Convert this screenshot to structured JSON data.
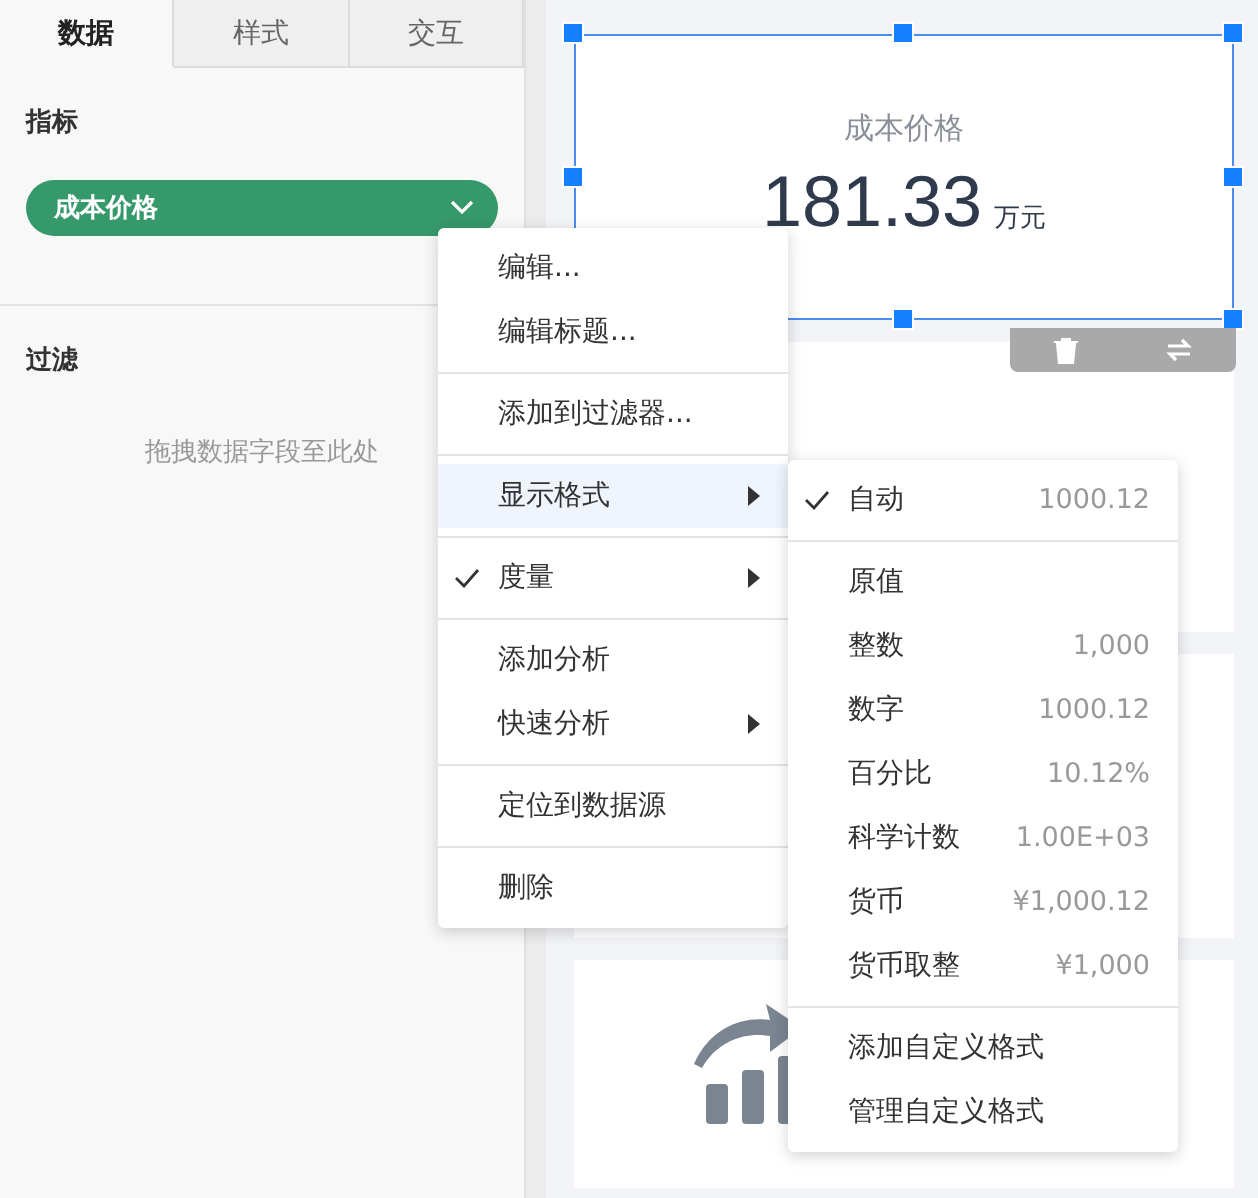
{
  "tabs": [
    {
      "label": "数据",
      "selected": true
    },
    {
      "label": "样式",
      "selected": false
    },
    {
      "label": "交互",
      "selected": false
    }
  ],
  "sidebar": {
    "measure_title": "指标",
    "measure": {
      "label": "成本价格"
    },
    "filter_title": "过滤",
    "filter_placeholder": "拖拽数据字段至此处"
  },
  "canvas": {
    "cards": [
      {
        "kind": "metric",
        "selected": true,
        "title": "成本价格",
        "value": "181.33",
        "unit": "万元"
      },
      {
        "kind": "blank",
        "selected": false
      },
      {
        "kind": "blank",
        "selected": false
      },
      {
        "kind": "icon",
        "selected": false
      }
    ]
  },
  "context_menu": {
    "items": [
      {
        "kind": "item",
        "label": "编辑...",
        "checked": false,
        "submenu": false,
        "selected": false
      },
      {
        "kind": "item",
        "label": "编辑标题...",
        "checked": false,
        "submenu": false,
        "selected": false
      },
      {
        "kind": "separator"
      },
      {
        "kind": "item",
        "label": "添加到过滤器...",
        "checked": false,
        "submenu": false,
        "selected": false
      },
      {
        "kind": "separator"
      },
      {
        "kind": "item",
        "label": "显示格式",
        "checked": false,
        "submenu": true,
        "selected": true
      },
      {
        "kind": "separator"
      },
      {
        "kind": "item",
        "label": "度量",
        "checked": true,
        "submenu": true,
        "selected": false
      },
      {
        "kind": "separator"
      },
      {
        "kind": "item",
        "label": "添加分析",
        "checked": false,
        "submenu": false,
        "selected": false
      },
      {
        "kind": "item",
        "label": "快速分析",
        "checked": false,
        "submenu": true,
        "selected": false
      },
      {
        "kind": "separator"
      },
      {
        "kind": "item",
        "label": "定位到数据源",
        "checked": false,
        "submenu": false,
        "selected": false
      },
      {
        "kind": "separator"
      },
      {
        "kind": "item",
        "label": "删除",
        "checked": false,
        "submenu": false,
        "selected": false
      }
    ]
  },
  "format_menu": {
    "items": [
      {
        "kind": "item",
        "label": "自动",
        "example": "1000.12",
        "checked": true
      },
      {
        "kind": "separator"
      },
      {
        "kind": "item",
        "label": "原值",
        "checked": false
      },
      {
        "kind": "item",
        "label": "整数",
        "example": "1,000",
        "checked": false
      },
      {
        "kind": "item",
        "label": "数字",
        "example": "1000.12",
        "checked": false
      },
      {
        "kind": "item",
        "label": "百分比",
        "example": "10.12%",
        "checked": false
      },
      {
        "kind": "item",
        "label": "科学计数",
        "example": "1.00E+03",
        "checked": false
      },
      {
        "kind": "item",
        "label": "货币",
        "example": "¥1,000.12",
        "checked": false
      },
      {
        "kind": "item",
        "label": "货币取整",
        "example": "¥1,000",
        "checked": false
      },
      {
        "kind": "separator"
      },
      {
        "kind": "item",
        "label": "添加自定义格式",
        "checked": false
      },
      {
        "kind": "item",
        "label": "管理自定义格式",
        "checked": false
      }
    ]
  }
}
